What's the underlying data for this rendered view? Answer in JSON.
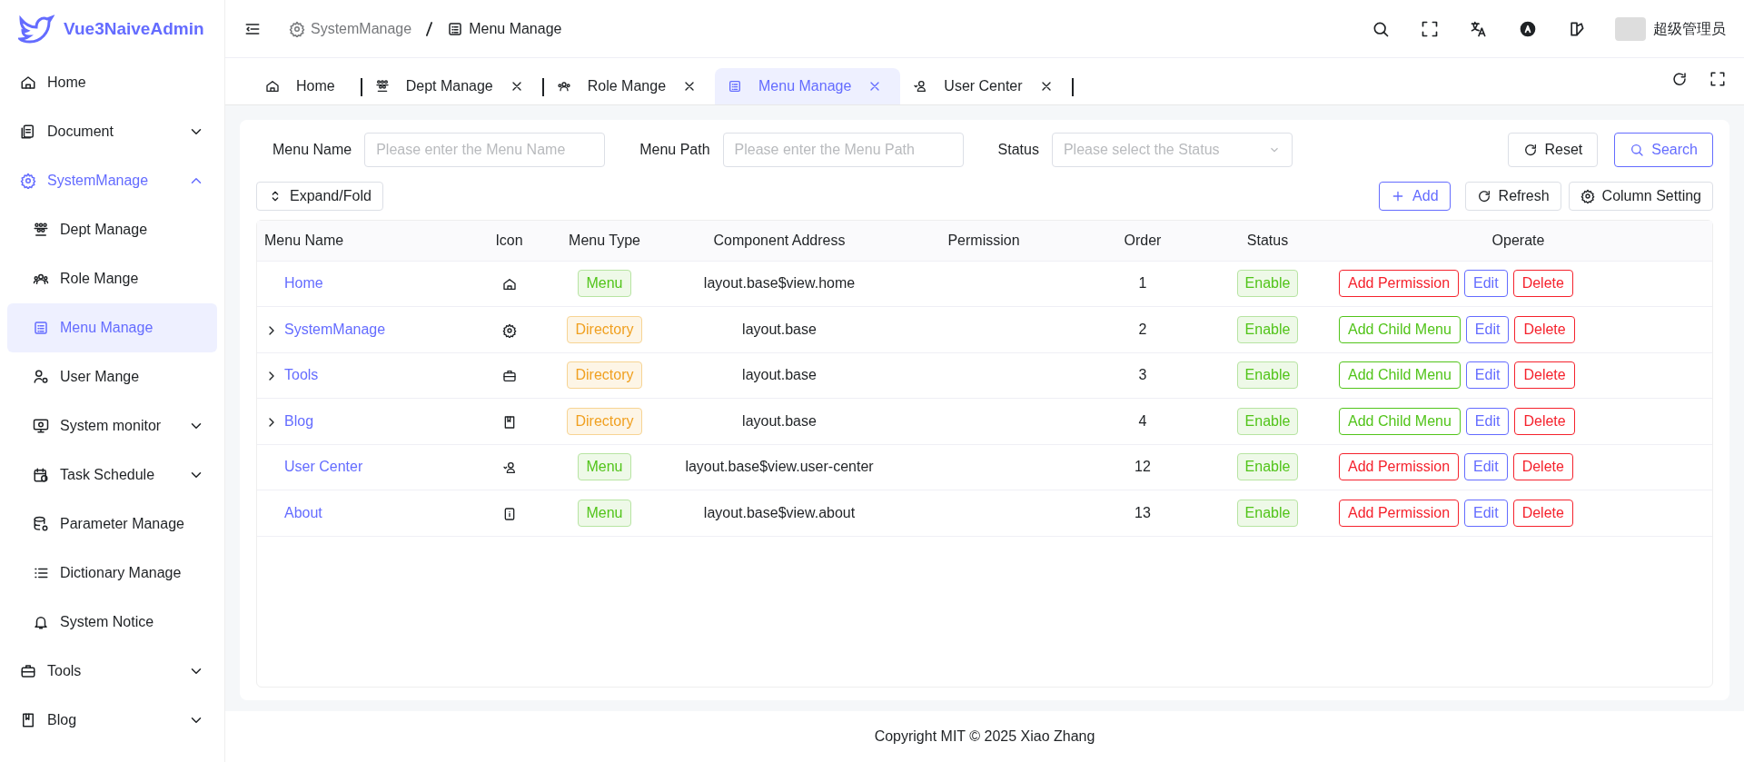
{
  "logo": {
    "title": "Vue3NaiveAdmin"
  },
  "sidebar": {
    "items": [
      {
        "label": "Home",
        "kind": "link",
        "selected": false
      },
      {
        "label": "Document",
        "kind": "group",
        "expanded": false,
        "selected": false
      },
      {
        "label": "SystemManage",
        "kind": "group",
        "expanded": true,
        "selected": false,
        "children": [
          {
            "label": "Dept Manage",
            "kind": "link",
            "selected": false
          },
          {
            "label": "Role Mange",
            "kind": "link",
            "selected": false
          },
          {
            "label": "Menu Manage",
            "kind": "link",
            "selected": true
          },
          {
            "label": "User Mange",
            "kind": "link",
            "selected": false
          },
          {
            "label": "System monitor",
            "kind": "group",
            "expanded": false,
            "selected": false
          },
          {
            "label": "Task Schedule",
            "kind": "group",
            "expanded": false,
            "selected": false
          },
          {
            "label": "Parameter Manage",
            "kind": "link",
            "selected": false
          },
          {
            "label": "Dictionary Manage",
            "kind": "link",
            "selected": false
          },
          {
            "label": "System Notice",
            "kind": "link",
            "selected": false
          }
        ]
      },
      {
        "label": "Tools",
        "kind": "group",
        "expanded": false,
        "selected": false
      },
      {
        "label": "Blog",
        "kind": "group",
        "expanded": false,
        "selected": false
      }
    ]
  },
  "header": {
    "breadcrumb": [
      "SystemManage",
      "Menu Manage"
    ],
    "user_name": "超级管理员"
  },
  "tabs": [
    {
      "label": "Home",
      "closable": false,
      "selected": false
    },
    {
      "label": "Dept Manage",
      "closable": true,
      "selected": false
    },
    {
      "label": "Role Mange",
      "closable": true,
      "selected": false
    },
    {
      "label": "Menu Manage",
      "closable": true,
      "selected": true
    },
    {
      "label": "User Center",
      "closable": true,
      "selected": false
    }
  ],
  "search_form": {
    "fields": [
      {
        "label": "Menu Name",
        "kind": "input",
        "placeholder": "Please enter the Menu Name"
      },
      {
        "label": "Menu Path",
        "kind": "input",
        "placeholder": "Please enter the Menu Path"
      },
      {
        "label": "Status",
        "kind": "select",
        "placeholder": "Please select the Status"
      }
    ],
    "buttons": [
      {
        "label": "Reset",
        "kind": "default"
      },
      {
        "label": "Search",
        "kind": "primary"
      }
    ]
  },
  "toolbar": {
    "left": [
      {
        "label": "Expand/Fold",
        "kind": "default"
      }
    ],
    "right": [
      {
        "label": "Add",
        "kind": "primary"
      },
      {
        "label": "Refresh",
        "kind": "default"
      },
      {
        "label": "Column Setting",
        "kind": "default"
      }
    ]
  },
  "table": {
    "columns": [
      "Menu Name",
      "Icon",
      "Menu Type",
      "Component Address",
      "Permission",
      "Order",
      "Status",
      "Operate"
    ],
    "rows": [
      {
        "name": "Home",
        "kind": "menu",
        "type": "Menu",
        "component": "layout.base$view.home",
        "order": "1",
        "status": "Enable",
        "actions": [
          {
            "label": "Add Permission",
            "kind": "danger"
          },
          {
            "label": "Edit",
            "kind": "primary"
          },
          {
            "label": "Delete",
            "kind": "danger"
          }
        ]
      },
      {
        "name": "SystemManage",
        "kind": "directory",
        "type": "Directory",
        "component": "layout.base",
        "order": "2",
        "status": "Enable",
        "actions": [
          {
            "label": "Add Child Menu",
            "kind": "success"
          },
          {
            "label": "Edit",
            "kind": "primary"
          },
          {
            "label": "Delete",
            "kind": "danger"
          }
        ]
      },
      {
        "name": "Tools",
        "kind": "directory",
        "type": "Directory",
        "component": "layout.base",
        "order": "3",
        "status": "Enable",
        "actions": [
          {
            "label": "Add Child Menu",
            "kind": "success"
          },
          {
            "label": "Edit",
            "kind": "primary"
          },
          {
            "label": "Delete",
            "kind": "danger"
          }
        ]
      },
      {
        "name": "Blog",
        "kind": "directory",
        "type": "Directory",
        "component": "layout.base",
        "order": "4",
        "status": "Enable",
        "actions": [
          {
            "label": "Add Child Menu",
            "kind": "success"
          },
          {
            "label": "Edit",
            "kind": "primary"
          },
          {
            "label": "Delete",
            "kind": "danger"
          }
        ]
      },
      {
        "name": "User Center",
        "kind": "menu",
        "type": "Menu",
        "component": "layout.base$view.user-center",
        "order": "12",
        "status": "Enable",
        "actions": [
          {
            "label": "Add Permission",
            "kind": "danger"
          },
          {
            "label": "Edit",
            "kind": "primary"
          },
          {
            "label": "Delete",
            "kind": "danger"
          }
        ]
      },
      {
        "name": "About",
        "kind": "menu",
        "type": "Menu",
        "component": "layout.base$view.about",
        "order": "13",
        "status": "Enable",
        "actions": [
          {
            "label": "Add Permission",
            "kind": "danger"
          },
          {
            "label": "Edit",
            "kind": "primary"
          },
          {
            "label": "Delete",
            "kind": "danger"
          }
        ]
      }
    ]
  },
  "footer": {
    "text": "Copyright MIT © 2025 Xiao Zhang"
  }
}
